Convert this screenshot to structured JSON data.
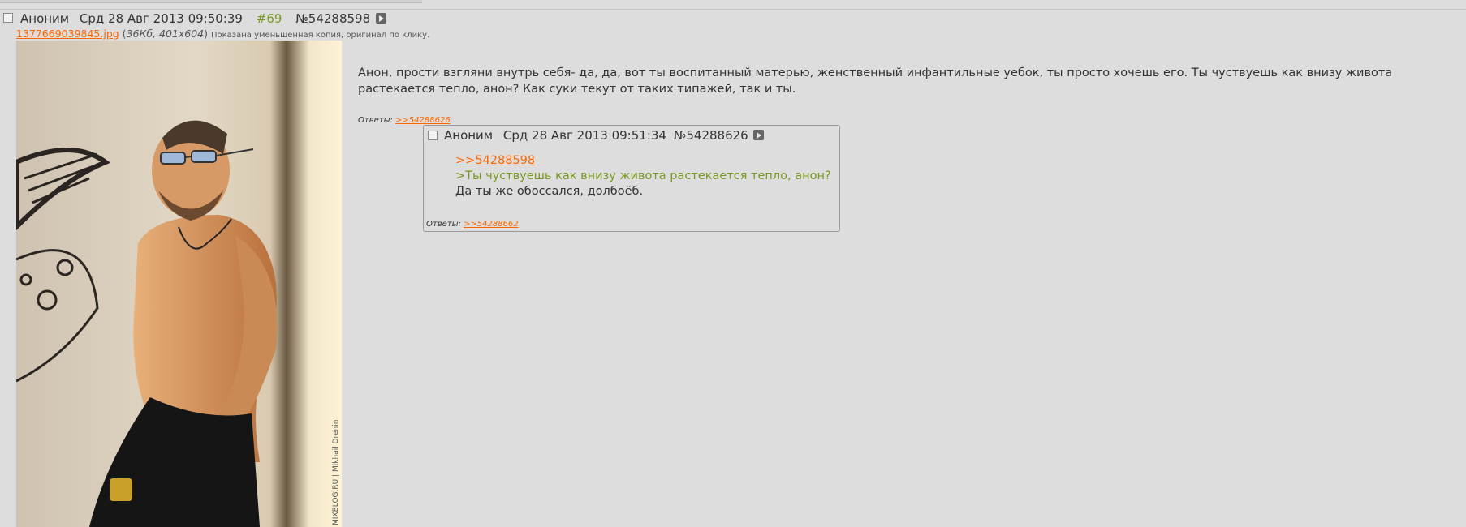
{
  "post": {
    "name": "Аноним",
    "date": "Срд 28 Авг 2013 09:50:39",
    "index": "#69",
    "number": "№54288598",
    "file": {
      "name": "1377669039845.jpg",
      "meta": "36Кб, 401x604",
      "note": "Показана уменьшенная копия, оригинал по клику."
    },
    "photo_watermark": "MIXBLOG.RU | Mikhail Drenin",
    "message": "Анон, прости взгляни внутрь себя- да, да, вот ты воспитанный матерью, женственный инфантильные уебок, ты просто хочешь его. Ты чуствуешь как внизу живота растекается тепло, анон? Как суки текут от таких типажей, так и ты.",
    "replies_label": "Ответы:",
    "reply_link": ">>54288626"
  },
  "reply": {
    "name": "Аноним",
    "date": "Срд 28 Авг 2013 09:51:34",
    "number": "№54288626",
    "ref_link": ">>54288598",
    "quote": ">Ты чуствуешь как внизу живота растекается тепло, анон?",
    "text": "Да ты же обоссался, долбоёб.",
    "replies_label": "Ответы:",
    "reply_link": ">>54288662"
  },
  "colors": {
    "background": "#dddddd",
    "link": "#ff6600",
    "greentext": "#789922"
  }
}
